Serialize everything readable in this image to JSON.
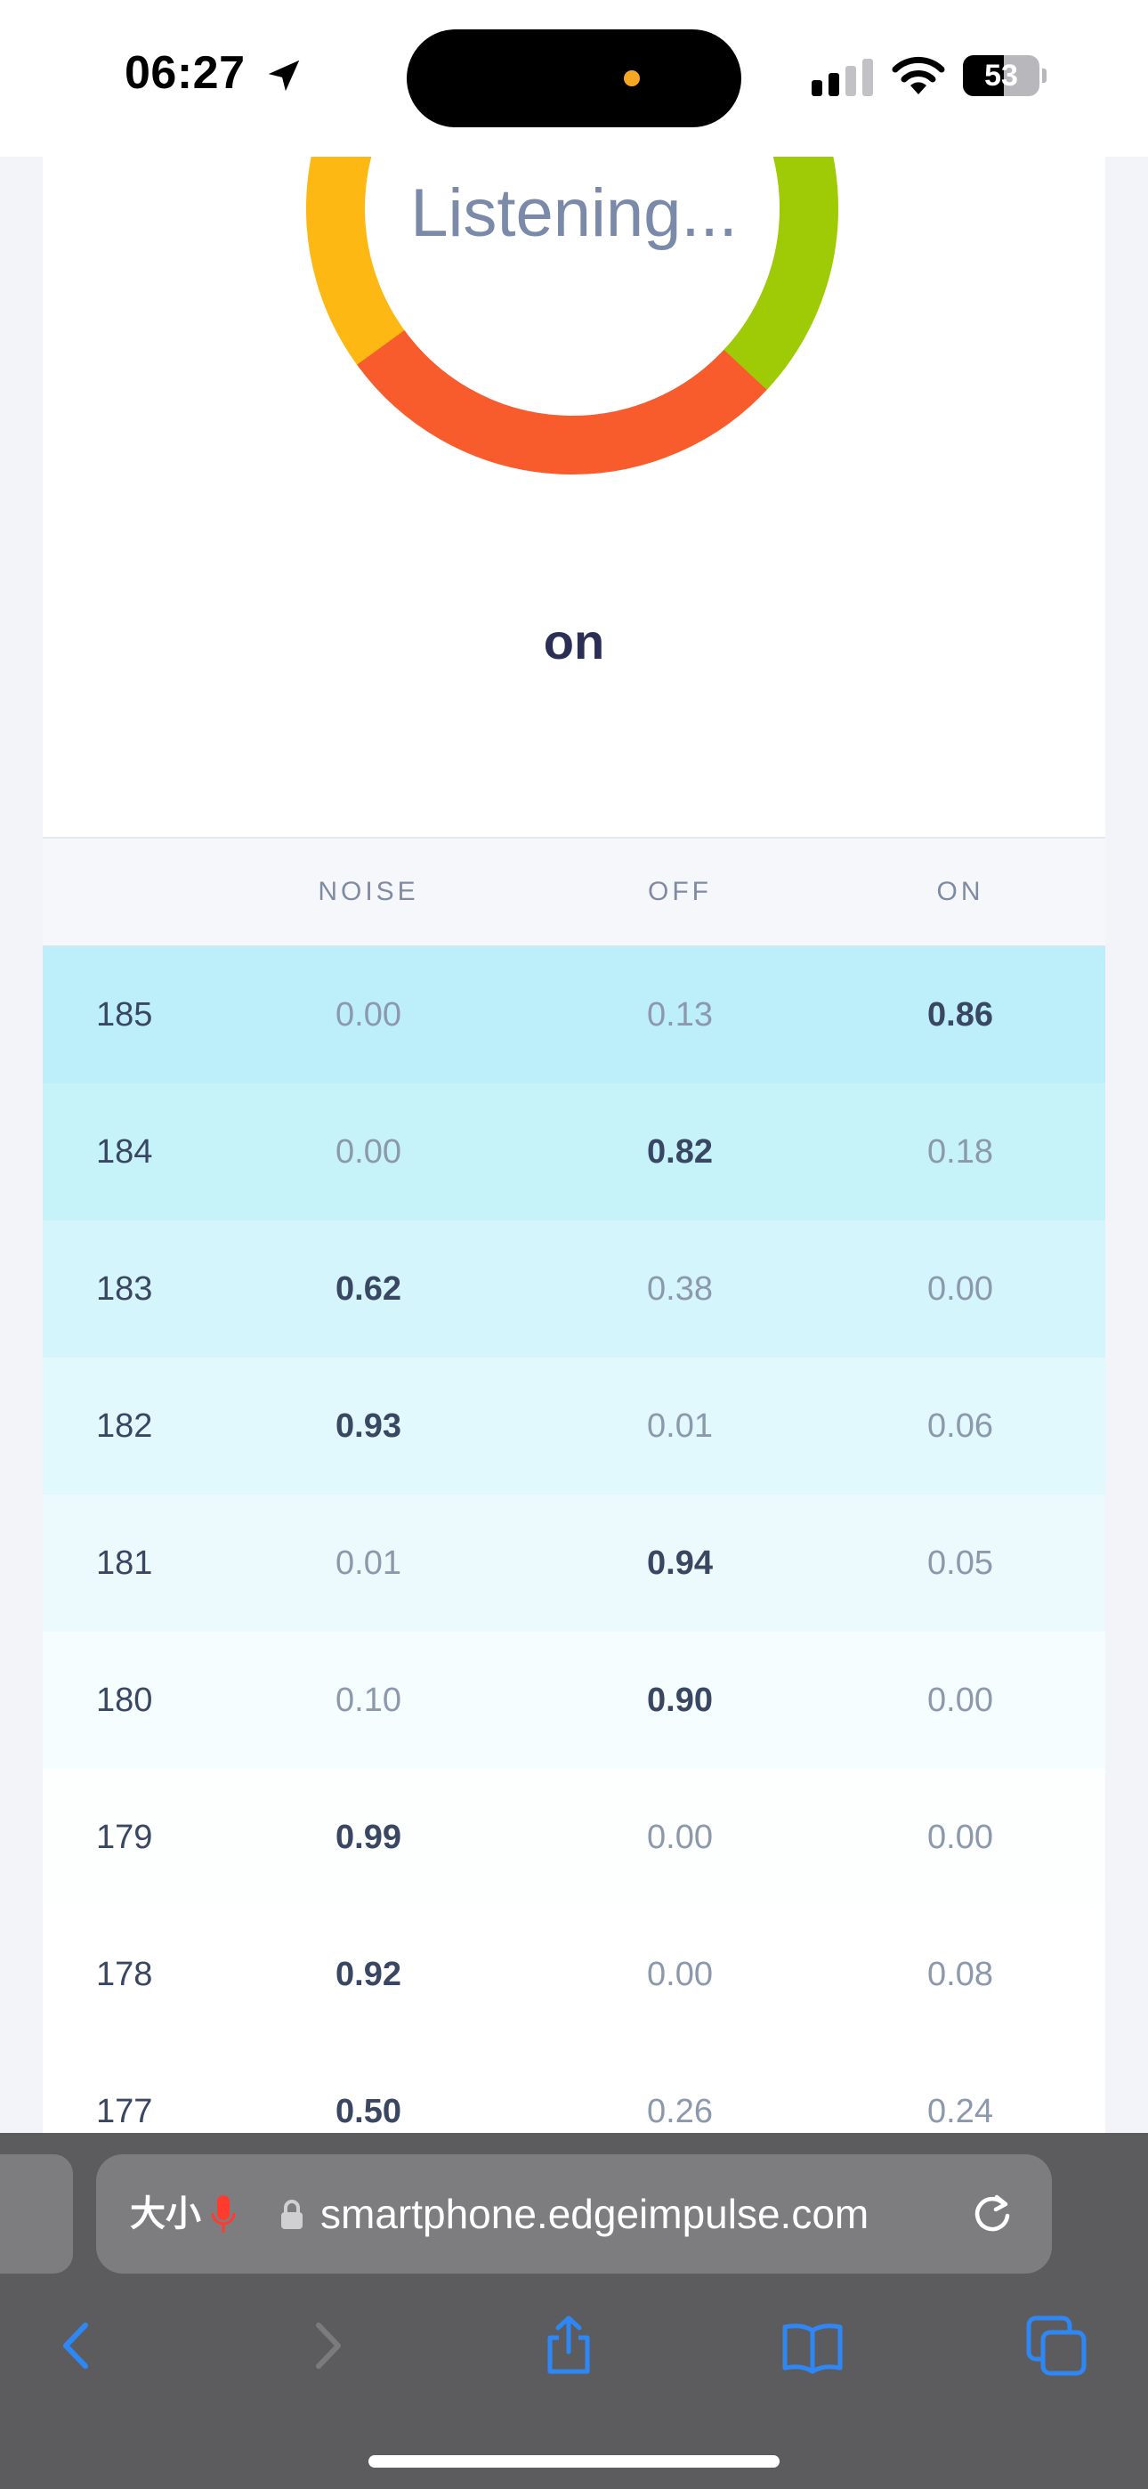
{
  "status_bar": {
    "time": "06:27",
    "battery": "53",
    "battery_level": 0.53
  },
  "gauge": {
    "label": "Listening...",
    "colors": [
      "#fdb813",
      "#f85b2c",
      "#9fcb06"
    ]
  },
  "prediction": "on",
  "table": {
    "headers": [
      "",
      "NOISE",
      "OFF",
      "ON"
    ],
    "rows": [
      {
        "id": "185",
        "noise": "0.00",
        "off": "0.13",
        "on": "0.86",
        "top": "on",
        "bg": "#bdeffa"
      },
      {
        "id": "184",
        "noise": "0.00",
        "off": "0.82",
        "on": "0.18",
        "top": "off",
        "bg": "#c6f2fa"
      },
      {
        "id": "183",
        "noise": "0.62",
        "off": "0.38",
        "on": "0.00",
        "top": "noise",
        "bg": "#d4f5fb"
      },
      {
        "id": "182",
        "noise": "0.93",
        "off": "0.01",
        "on": "0.06",
        "top": "noise",
        "bg": "#e1f8fc"
      },
      {
        "id": "181",
        "noise": "0.01",
        "off": "0.94",
        "on": "0.05",
        "top": "off",
        "bg": "#ecfafd"
      },
      {
        "id": "180",
        "noise": "0.10",
        "off": "0.90",
        "on": "0.00",
        "top": "off",
        "bg": "#f5fdfe"
      },
      {
        "id": "179",
        "noise": "0.99",
        "off": "0.00",
        "on": "0.00",
        "top": "noise",
        "bg": "#fdfefe"
      },
      {
        "id": "178",
        "noise": "0.92",
        "off": "0.00",
        "on": "0.08",
        "top": "noise",
        "bg": "#ffffff"
      },
      {
        "id": "177",
        "noise": "0.50",
        "off": "0.26",
        "on": "0.24",
        "top": "noise",
        "bg": "#ffffff"
      }
    ]
  },
  "browser": {
    "aa_label": "大小",
    "url": "smartphone.edgeimpulse.com",
    "toolbar": [
      "back-icon",
      "forward-icon",
      "share-icon",
      "bookmarks-icon",
      "tabs-icon"
    ]
  }
}
